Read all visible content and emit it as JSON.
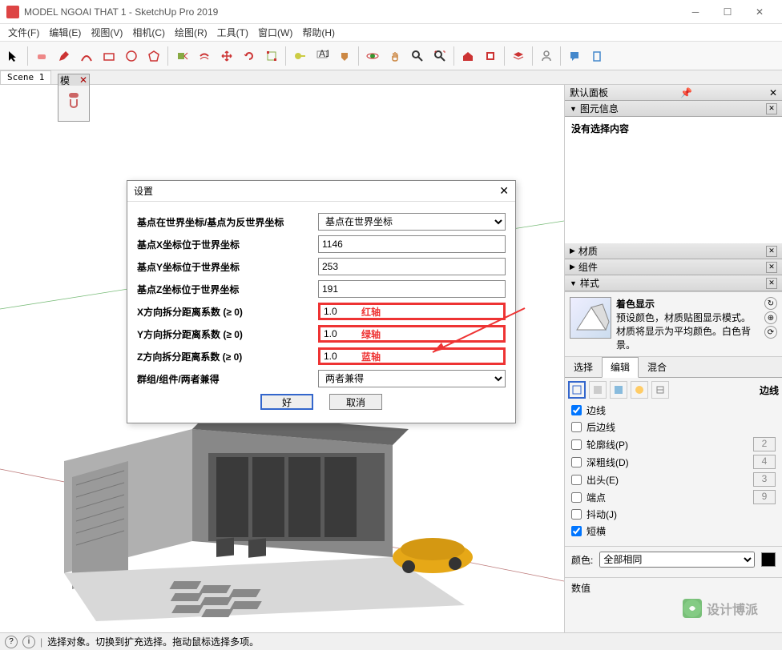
{
  "window": {
    "title": "MODEL NGOAI THAT 1 - SketchUp Pro 2019"
  },
  "menu": [
    "文件(F)",
    "编辑(E)",
    "视图(V)",
    "相机(C)",
    "绘图(R)",
    "工具(T)",
    "窗口(W)",
    "帮助(H)"
  ],
  "scene": {
    "tab1": "Scene 1"
  },
  "float": {
    "label": "模",
    "close": "✕"
  },
  "dialog": {
    "title": "设置",
    "rows": {
      "coord_label": "基点在世界坐标/基点为反世界坐标",
      "coord_value": "基点在世界坐标",
      "x_label": "基点X坐标位于世界坐标",
      "x_value": "1146",
      "y_label": "基点Y坐标位于世界坐标",
      "y_value": "253",
      "z_label": "基点Z坐标位于世界坐标",
      "z_value": "191",
      "fx_label": "X方向拆分距离系数 (≥ 0)",
      "fx_value": "1.0",
      "fy_label": "Y方向拆分距离系数 (≥ 0)",
      "fy_value": "1.0",
      "fz_label": "Z方向拆分距离系数 (≥ 0)",
      "fz_value": "1.0",
      "grp_label": "群组/组件/两者兼得",
      "grp_value": "两者兼得"
    },
    "annotations": {
      "red": "红轴",
      "green": "绿轴",
      "blue": "蓝轴"
    },
    "buttons": {
      "ok": "好",
      "cancel": "取消"
    }
  },
  "panel": {
    "header": "默认面板",
    "sections": {
      "entity": "图元信息",
      "material": "材质",
      "component": "组件",
      "style": "样式"
    },
    "entity_msg": "没有选择内容",
    "style": {
      "name": "着色显示",
      "desc": "预设颜色，材质贴图显示模式。材质将显示为平均颜色。白色背景。"
    },
    "subtabs": {
      "select": "选择",
      "edit": "编辑",
      "mix": "混合"
    },
    "edge_label": "边线",
    "edges": {
      "edge": "边线",
      "back": "后边线",
      "profile": "轮廓线(P)",
      "profile_v": "2",
      "depth": "深粗线(D)",
      "depth_v": "4",
      "ext": "出头(E)",
      "ext_v": "3",
      "end": "端点",
      "end_v": "9",
      "jitter": "抖动(J)",
      "short": "短横"
    },
    "color_label": "颜色:",
    "color_value": "全部相同",
    "value_label": "数值"
  },
  "status": {
    "text": "选择对象。切换到扩充选择。拖动鼠标选择多项。"
  },
  "watermark": "设计博派"
}
